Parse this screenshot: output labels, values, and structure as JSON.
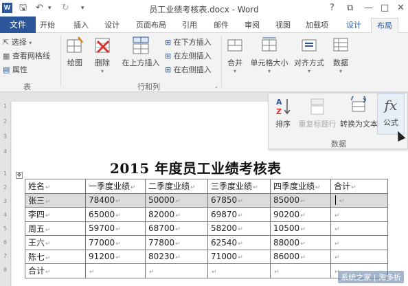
{
  "app": {
    "title": "员工业绩考核表.docx - Word",
    "logo_letter": "W",
    "window_controls": [
      "?",
      "⧉",
      "—",
      "□",
      "✕"
    ]
  },
  "tabs": [
    {
      "label": "文件",
      "kind": "file"
    },
    {
      "label": "开始"
    },
    {
      "label": "插入"
    },
    {
      "label": "设计"
    },
    {
      "label": "页面布局"
    },
    {
      "label": "引用"
    },
    {
      "label": "邮件"
    },
    {
      "label": "审阅"
    },
    {
      "label": "视图"
    },
    {
      "label": "加载项"
    },
    {
      "label": "设计",
      "kind": "context"
    },
    {
      "label": "布局",
      "kind": "context-active"
    }
  ],
  "ribbon": {
    "table_group": {
      "select": "选择",
      "gridlines": "查看网格线",
      "properties": "属性",
      "label": "表"
    },
    "draw": "绘图",
    "delete": "删除",
    "insert_above": "在上方插入",
    "insert_below": "在下方插入",
    "insert_left": "在左侧插入",
    "insert_right": "在右侧插入",
    "rows_cols_label": "行和列",
    "merge": "合并",
    "cell_size": "单元格大小",
    "alignment": "对齐方式",
    "data": "数据"
  },
  "data_panel": {
    "sort": "排序",
    "repeat_header": "重复标题行",
    "convert_text": "转换为文本",
    "formula": "公式",
    "formula_symbol": "fx",
    "group": "数据"
  },
  "document": {
    "heading": "2015 年度员工业绩考核表",
    "table": {
      "header": [
        "姓名",
        "一季度业绩",
        "二季度业绩",
        "三季度业绩",
        "四季度业绩",
        "合计"
      ],
      "rows": [
        [
          "张三",
          "78400",
          "50000",
          "67850",
          "85000",
          ""
        ],
        [
          "李四",
          "65000",
          "82000",
          "69870",
          "90200",
          ""
        ],
        [
          "周五",
          "59700",
          "68700",
          "58200",
          "10500",
          ""
        ],
        [
          "王六",
          "77000",
          "77800",
          "62540",
          "88000",
          ""
        ],
        [
          "陈七",
          "91200",
          "80230",
          "71000",
          "86000",
          ""
        ],
        [
          "合计",
          "",
          "",
          "",
          "",
          ""
        ]
      ]
    }
  },
  "watermark": "系统之家 | 淘多折",
  "colors": {
    "accent": "#2b579a",
    "selected_row": "#dcdcdc"
  }
}
